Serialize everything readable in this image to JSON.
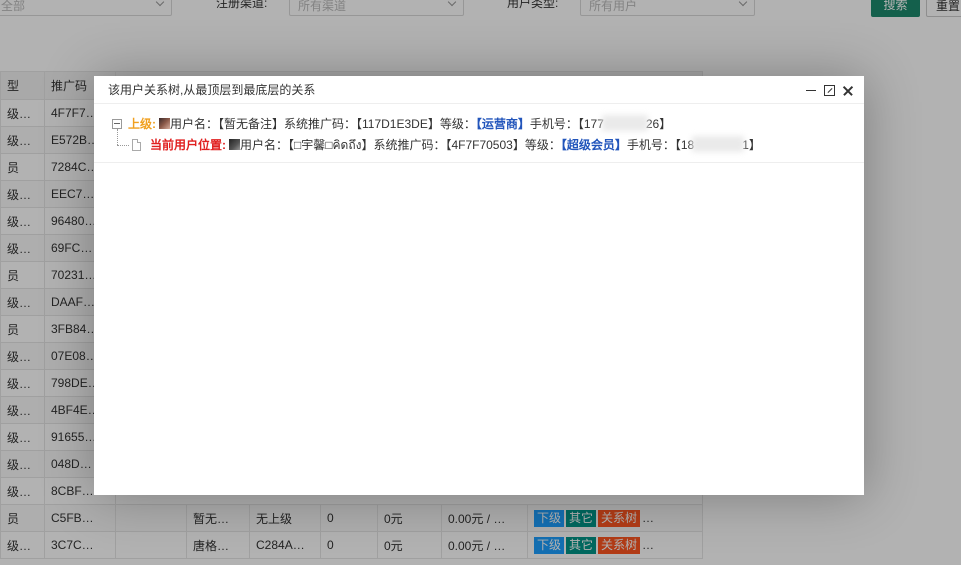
{
  "filters": {
    "select1_value": "全部",
    "channel_label": "注册渠道:",
    "channel_value": "所有渠道",
    "user_type_label": "用户类型:",
    "user_type_value": "所有用户",
    "search_label": "搜索",
    "reset_label": "重置"
  },
  "table": {
    "headers": [
      "型",
      "推广码"
    ],
    "rows": [
      [
        "级…",
        "4F7F7…"
      ],
      [
        "级…",
        "E572B…"
      ],
      [
        "员",
        "7284C…"
      ],
      [
        "级…",
        "EEC7…"
      ],
      [
        "级…",
        "96480…"
      ],
      [
        "级…",
        "69FC…"
      ],
      [
        "员",
        "70231…"
      ],
      [
        "级…",
        "DAAF…"
      ],
      [
        "员",
        "3FB84…"
      ],
      [
        "级…",
        "07E08…"
      ],
      [
        "级…",
        "798DE…"
      ],
      [
        "级…",
        "4BF4E…"
      ],
      [
        "级…",
        "91655…"
      ],
      [
        "级…",
        "048D…"
      ],
      [
        "级…",
        "8CBF…"
      ]
    ],
    "full_rows": [
      {
        "c0": "员",
        "c1": "C5FB…",
        "c2": "",
        "c3": "暂无…",
        "c4": "无上级",
        "c5": "0",
        "c6": "0元",
        "c7": "0.00元 / …",
        "ops": [
          "下级",
          "其它",
          "关系树"
        ],
        "more": "…"
      },
      {
        "c0": "级…",
        "c1": "3C7C…",
        "c2": "",
        "c3": "唐格…",
        "c4": "C284A…",
        "c5": "0",
        "c6": "0元",
        "c7": "0.00元 / …",
        "ops": [
          "下级",
          "其它",
          "关系树"
        ],
        "more": "…"
      }
    ]
  },
  "modal": {
    "title": "该用户关系树,从最顶层到最底层的关系",
    "parent": {
      "label": "上级:",
      "text": "用户名：【暂无备注】系统推广码：【117D1E3DE】等级：",
      "level": "【运营商】",
      "phone_prefix": "手机号：【177",
      "phone_suffix": "26】"
    },
    "current": {
      "label": "当前用户位置:",
      "text": "用户名：【□宇馨□คิดถึง】系统推广码：【4F7F70503】等级：",
      "level": "【超级会员】",
      "phone_prefix": "手机号：【18",
      "phone_suffix": "1】"
    }
  }
}
